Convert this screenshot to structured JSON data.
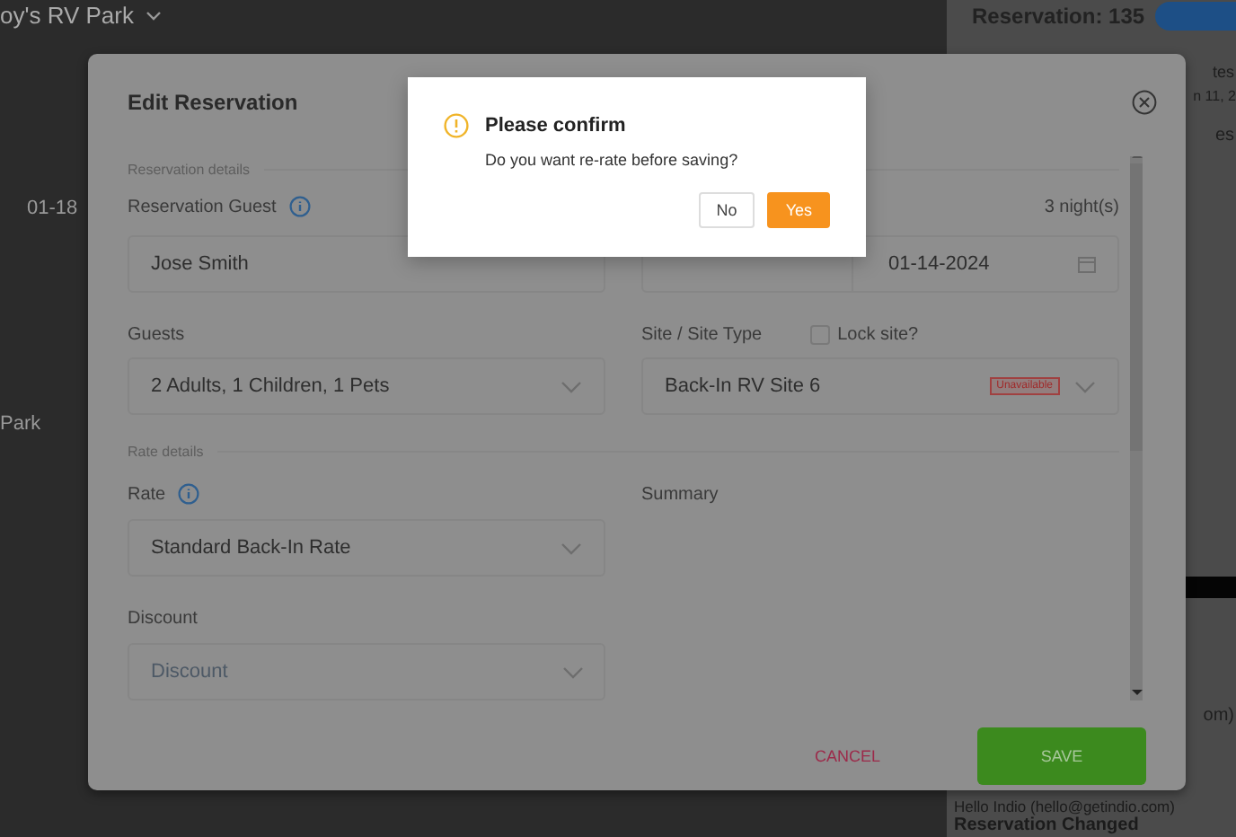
{
  "background": {
    "park_name": "oy's RV Park",
    "row_date": "01-18",
    "row_label": "Park",
    "panel": {
      "title": "Reservation: 135",
      "fragments": [
        "tes",
        "n 11, 2",
        "es"
      ],
      "email_fragment": "om)",
      "sender": "Hello Indio (hello@getindio.com)",
      "event": "Reservation Changed"
    }
  },
  "modal": {
    "title": "Edit Reservation",
    "reservation_section": "Reservation details",
    "guest": {
      "label": "Reservation Guest",
      "value": "Jose Smith"
    },
    "nights": "3 night(s)",
    "dates": {
      "end": "01-14-2024"
    },
    "guests": {
      "label": "Guests",
      "value": "2 Adults, 1 Children, 1 Pets"
    },
    "site": {
      "label": "Site / Site Type",
      "lock_label": "Lock site?",
      "lock_checked": false,
      "value": "Back-In RV Site 6",
      "badge": "Unavailable"
    },
    "rate_section": "Rate details",
    "rate": {
      "label": "Rate",
      "value": "Standard Back-In Rate"
    },
    "summary_label": "Summary",
    "discount": {
      "label": "Discount",
      "placeholder": "Discount"
    },
    "cancel": "CANCEL",
    "save": "SAVE"
  },
  "confirm": {
    "title": "Please confirm",
    "message": "Do you want re-rate before saving?",
    "buttons": [
      {
        "label": "No",
        "kind": "secondary"
      },
      {
        "label": "Yes",
        "kind": "primary"
      }
    ]
  }
}
